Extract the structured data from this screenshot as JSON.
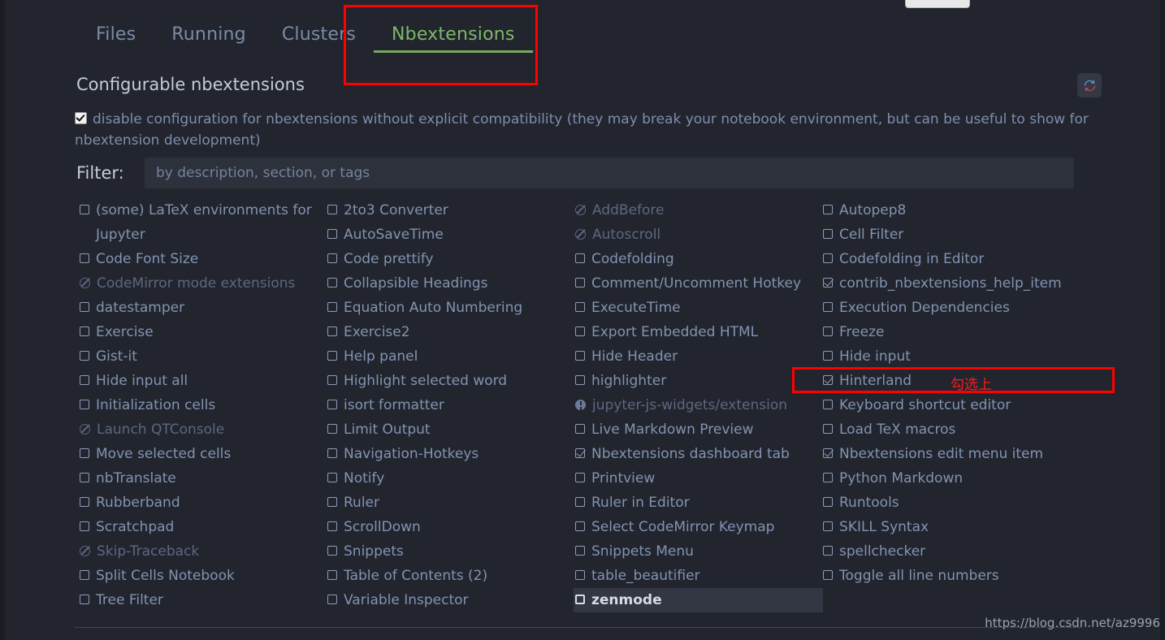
{
  "top_stub": {
    "present": true
  },
  "tabs": [
    {
      "label": "Files",
      "active": false
    },
    {
      "label": "Running",
      "active": false
    },
    {
      "label": "Clusters",
      "active": false
    },
    {
      "label": "Nbextensions",
      "active": true
    }
  ],
  "header": {
    "title": "Configurable nbextensions",
    "refresh_icon": "refresh-icon"
  },
  "disable_config": {
    "checked": true,
    "text": "disable configuration for nbextensions without explicit compatibility (they may break your notebook environment, but can be useful to show for nbextension development)"
  },
  "filter": {
    "label": "Filter:",
    "value": "",
    "placeholder": "by description, section, or tags"
  },
  "annotations": [
    {
      "name": "nbextensions-tab-highlight",
      "color": "#ff0000",
      "text": ""
    },
    {
      "name": "hinterland-highlight",
      "color": "#ff0000",
      "text": "勾选上"
    }
  ],
  "colors": {
    "background": "#22252d",
    "text": "#8293b2",
    "text_disabled": "#5c6880",
    "accent_tab": "#7cb86a",
    "annotation": "#ff0000",
    "highlight_row_bg": "#323743"
  },
  "extensions": {
    "columns": [
      {
        "items": [
          {
            "label": "(some) LaTeX environments for Jupyter",
            "state": "unchecked"
          },
          {
            "label": "Code Font Size",
            "state": "unchecked"
          },
          {
            "label": "CodeMirror mode extensions",
            "state": "banned"
          },
          {
            "label": "datestamper",
            "state": "unchecked"
          },
          {
            "label": "Exercise",
            "state": "unchecked"
          },
          {
            "label": "Gist-it",
            "state": "unchecked"
          },
          {
            "label": "Hide input all",
            "state": "unchecked"
          },
          {
            "label": "Initialization cells",
            "state": "unchecked"
          },
          {
            "label": "Launch QTConsole",
            "state": "banned"
          },
          {
            "label": "Move selected cells",
            "state": "unchecked"
          },
          {
            "label": "nbTranslate",
            "state": "unchecked"
          },
          {
            "label": "Rubberband",
            "state": "unchecked"
          },
          {
            "label": "Scratchpad",
            "state": "unchecked"
          },
          {
            "label": "Skip-Traceback",
            "state": "banned"
          },
          {
            "label": "Split Cells Notebook",
            "state": "unchecked"
          },
          {
            "label": "Tree Filter",
            "state": "unchecked"
          }
        ]
      },
      {
        "items": [
          {
            "label": "2to3 Converter",
            "state": "unchecked"
          },
          {
            "label": "AutoSaveTime",
            "state": "unchecked"
          },
          {
            "label": "Code prettify",
            "state": "unchecked"
          },
          {
            "label": "Collapsible Headings",
            "state": "unchecked"
          },
          {
            "label": "Equation Auto Numbering",
            "state": "unchecked"
          },
          {
            "label": "Exercise2",
            "state": "unchecked"
          },
          {
            "label": "Help panel",
            "state": "unchecked"
          },
          {
            "label": "Highlight selected word",
            "state": "unchecked"
          },
          {
            "label": "isort formatter",
            "state": "unchecked"
          },
          {
            "label": "Limit Output",
            "state": "unchecked"
          },
          {
            "label": "Navigation-Hotkeys",
            "state": "unchecked"
          },
          {
            "label": "Notify",
            "state": "unchecked"
          },
          {
            "label": "Ruler",
            "state": "unchecked"
          },
          {
            "label": "ScrollDown",
            "state": "unchecked"
          },
          {
            "label": "Snippets",
            "state": "unchecked"
          },
          {
            "label": "Table of Contents (2)",
            "state": "unchecked"
          },
          {
            "label": "Variable Inspector",
            "state": "unchecked"
          }
        ]
      },
      {
        "items": [
          {
            "label": "AddBefore",
            "state": "banned"
          },
          {
            "label": "Autoscroll",
            "state": "banned"
          },
          {
            "label": "Codefolding",
            "state": "unchecked"
          },
          {
            "label": "Comment/Uncomment Hotkey",
            "state": "unchecked"
          },
          {
            "label": "ExecuteTime",
            "state": "unchecked"
          },
          {
            "label": "Export Embedded HTML",
            "state": "unchecked"
          },
          {
            "label": "Hide Header",
            "state": "unchecked"
          },
          {
            "label": "highlighter",
            "state": "unchecked"
          },
          {
            "label": "jupyter-js-widgets/extension",
            "state": "info"
          },
          {
            "label": "Live Markdown Preview",
            "state": "unchecked"
          },
          {
            "label": "Nbextensions dashboard tab",
            "state": "checked"
          },
          {
            "label": "Printview",
            "state": "unchecked"
          },
          {
            "label": "Ruler in Editor",
            "state": "unchecked"
          },
          {
            "label": "Select CodeMirror Keymap",
            "state": "unchecked"
          },
          {
            "label": "Snippets Menu",
            "state": "unchecked"
          },
          {
            "label": "table_beautifier",
            "state": "unchecked"
          },
          {
            "label": "zenmode",
            "state": "unchecked",
            "highlighted": true
          }
        ]
      },
      {
        "items": [
          {
            "label": "Autopep8",
            "state": "unchecked"
          },
          {
            "label": "Cell Filter",
            "state": "unchecked"
          },
          {
            "label": "Codefolding in Editor",
            "state": "unchecked"
          },
          {
            "label": "contrib_nbextensions_help_item",
            "state": "checked"
          },
          {
            "label": "Execution Dependencies",
            "state": "unchecked"
          },
          {
            "label": "Freeze",
            "state": "unchecked"
          },
          {
            "label": "Hide input",
            "state": "unchecked"
          },
          {
            "label": "Hinterland",
            "state": "checked"
          },
          {
            "label": "Keyboard shortcut editor",
            "state": "unchecked"
          },
          {
            "label": "Load TeX macros",
            "state": "unchecked"
          },
          {
            "label": "Nbextensions edit menu item",
            "state": "checked"
          },
          {
            "label": "Python Markdown",
            "state": "unchecked"
          },
          {
            "label": "Runtools",
            "state": "unchecked"
          },
          {
            "label": "SKILL Syntax",
            "state": "unchecked"
          },
          {
            "label": "spellchecker",
            "state": "unchecked"
          },
          {
            "label": "Toggle all line numbers",
            "state": "unchecked"
          }
        ]
      }
    ]
  },
  "watermark": "https://blog.csdn.net/az9996"
}
